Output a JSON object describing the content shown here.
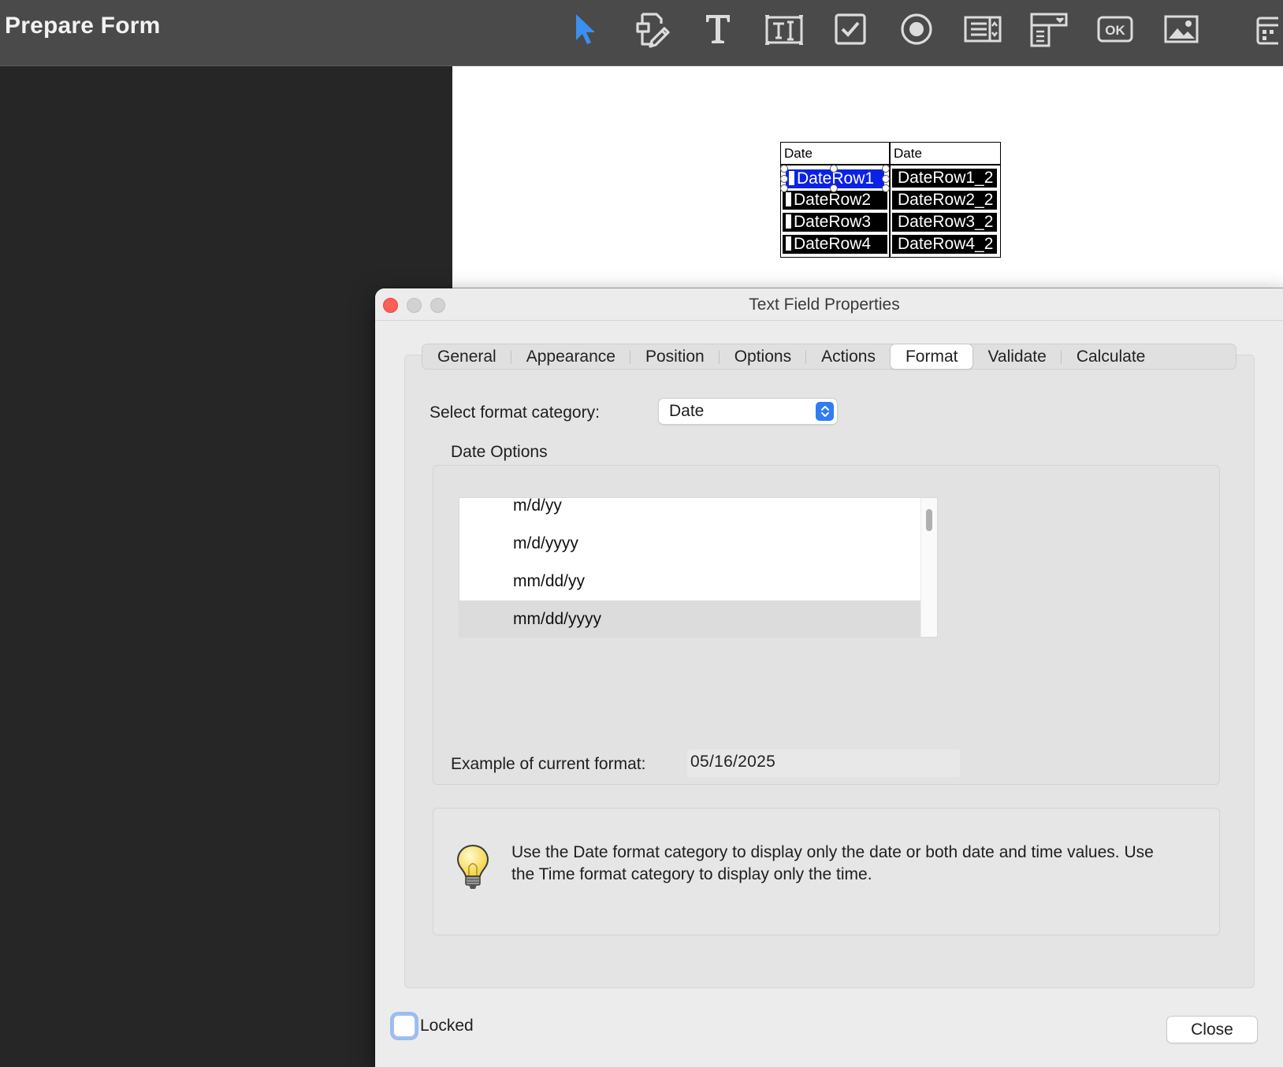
{
  "app": {
    "title": "Prepare Form"
  },
  "toolbar": {
    "tools": [
      {
        "name": "select-pointer-icon"
      },
      {
        "name": "edit-fields-icon"
      },
      {
        "name": "text-icon"
      },
      {
        "name": "text-field-icon"
      },
      {
        "name": "checkbox-icon"
      },
      {
        "name": "radio-button-icon"
      },
      {
        "name": "list-box-icon"
      },
      {
        "name": "dropdown-icon"
      },
      {
        "name": "button-icon",
        "label": "OK"
      },
      {
        "name": "image-icon"
      },
      {
        "name": "date-field-icon"
      }
    ],
    "accent": "#3b8ff0"
  },
  "pdf_table": {
    "headers": [
      "Date",
      "Date"
    ],
    "col1": [
      "DateRow1",
      "DateRow2",
      "DateRow3",
      "DateRow4"
    ],
    "col2": [
      "DateRow1_2",
      "DateRow2_2",
      "DateRow3_2",
      "DateRow4_2"
    ],
    "selected_field": "DateRow1"
  },
  "dialog": {
    "title": "Text Field Properties",
    "tabs": [
      "General",
      "Appearance",
      "Position",
      "Options",
      "Actions",
      "Format",
      "Validate",
      "Calculate"
    ],
    "active_tab": "Format",
    "format_category_label": "Select format category:",
    "format_category_value": "Date",
    "date_options_label": "Date Options",
    "date_formats": [
      "m/d/yy",
      "m/d/yyyy",
      "mm/dd/yy",
      "mm/dd/yyyy"
    ],
    "selected_format": "mm/dd/yyyy",
    "example_label": "Example of current format:",
    "example_value": "05/16/2025",
    "tip": "Use the Date format category to display only the date or both date and time values. Use the Time format category to display only the time.",
    "locked_label": "Locked",
    "locked_checked": false,
    "close_label": "Close"
  }
}
